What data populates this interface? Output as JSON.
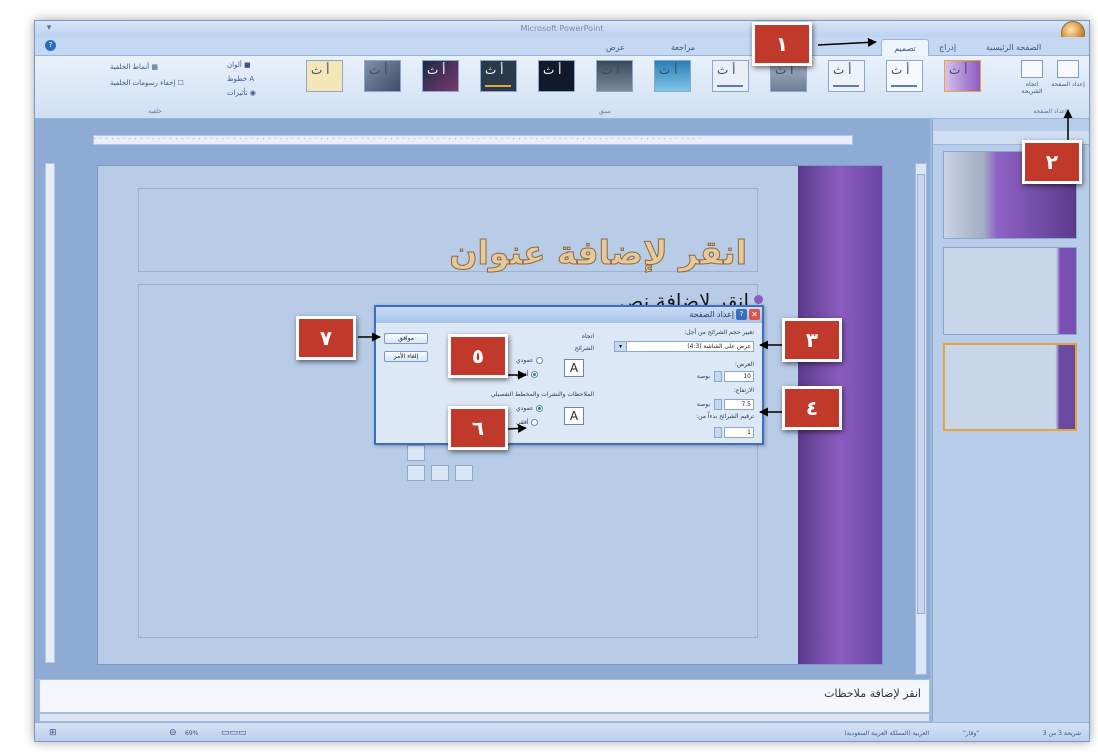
{
  "window": {
    "title": "Microsoft PowerPoint"
  },
  "tabs": [
    {
      "label": "الصفحة الرئيسية"
    },
    {
      "label": "إدراج"
    },
    {
      "label": "تصميم"
    },
    {
      "label": "مراجعة"
    },
    {
      "label": "عرض"
    }
  ],
  "ribbon": {
    "setup_buttons": [
      "إعداد الصفحة",
      "اتجاه الشريحة"
    ],
    "group_setup": "إعداد الصفحة",
    "group_themes": "نسق",
    "theme_letter": "أ ث",
    "theme_options": [
      "ألوان",
      "خطوط",
      "تأثيرات"
    ],
    "background_styles": "أنماط الخلفية",
    "hide_background": "إخفاء رسومات الخلفية",
    "group_background": "خلفية"
  },
  "slide": {
    "title_placeholder": "انقر لإضافة عنوان",
    "content_placeholder": "انقر لإضافة نص"
  },
  "dialog": {
    "title": "إعداد الصفحة",
    "size_label": "تغيير حجم الشرائح من أجل:",
    "size_value": "عرض على الشاشة (4:3)",
    "width_label": "العرض:",
    "width_value": "10",
    "height_label": "الارتفاع:",
    "height_value": "7.5",
    "unit": "بوصة",
    "number_label": "ترقيم الشرائح بدءاً من:",
    "number_value": "1",
    "orientation_label": "اتجاه",
    "slides_label": "الشرائح",
    "notes_label": "الملاحظات والنشرات والمخطط التفصيلي",
    "portrait": "عمودي",
    "landscape": "أفقي",
    "ok": "موافق",
    "cancel": "إلغاء الأمر",
    "slides_orientation": "landscape",
    "notes_orientation": "portrait"
  },
  "notes": {
    "placeholder": "انقر لإضافة ملاحظات"
  },
  "status": {
    "slide_info": "شريحة 3 من 3",
    "theme": "\"وقار\"",
    "language": "العربية (المملكة العربية السعودية)",
    "zoom": "69%"
  },
  "callouts": [
    "١",
    "٢",
    "٣",
    "٤",
    "٥",
    "٦",
    "٧"
  ],
  "colors": {
    "callout": "#c0392b",
    "accent_purple": "#8c5cc0",
    "dialog_border": "#3c6fc0"
  }
}
